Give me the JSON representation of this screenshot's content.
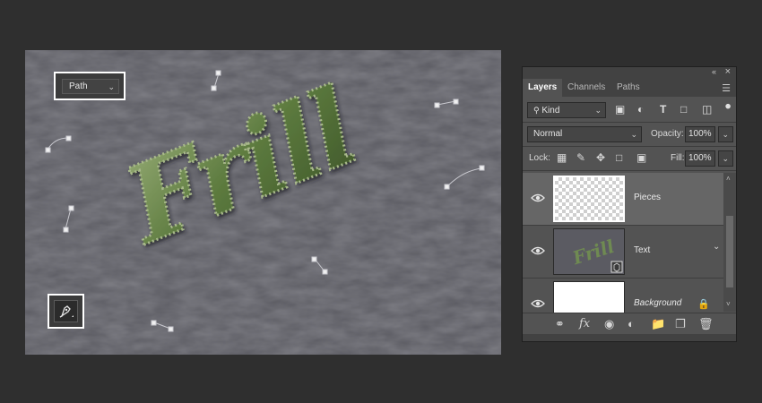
{
  "canvas": {
    "path_mode": {
      "label": "Path",
      "options_selected": "Path"
    },
    "artwork_text": "Frill",
    "colors": {
      "paper": "#58585f",
      "text_green": "#6f8a52",
      "anchor": "#e8e8e8"
    }
  },
  "layers_panel": {
    "tabs": [
      {
        "label": "Layers",
        "active": true
      },
      {
        "label": "Channels",
        "active": false
      },
      {
        "label": "Paths",
        "active": false
      }
    ],
    "filter": {
      "label": "Kind"
    },
    "blend_mode": "Normal",
    "opacity": {
      "label": "Opacity:",
      "value": "100%"
    },
    "lock": {
      "label": "Lock:"
    },
    "fill": {
      "label": "Fill:",
      "value": "100%"
    },
    "layers": [
      {
        "name": "Pieces",
        "selected": true,
        "thumbnail": "transparent"
      },
      {
        "name": "Text",
        "selected": false,
        "thumbnail": "smart-object"
      },
      {
        "name": "Background",
        "selected": false,
        "thumbnail": "white",
        "locked": true
      }
    ],
    "footer_icons": [
      "link-icon",
      "fx-icon",
      "mask-icon",
      "adjustment-icon",
      "folder-icon",
      "new-layer-icon",
      "trash-icon"
    ],
    "footer_fx_label": "fx"
  }
}
